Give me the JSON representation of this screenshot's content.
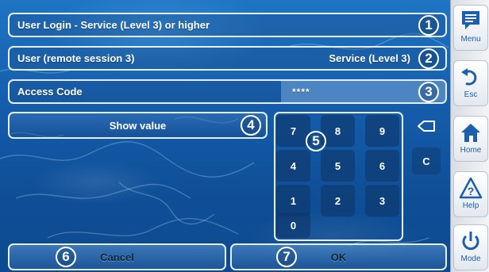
{
  "login_row": {
    "label": "User Login - Service (Level 3) or higher",
    "marker": "1"
  },
  "user_row": {
    "label": "User (remote session 3)",
    "value": "Service (Level 3)",
    "marker": "2"
  },
  "access_row": {
    "label": "Access Code",
    "value": "****",
    "marker": "3"
  },
  "show_value": {
    "label": "Show value",
    "marker": "4"
  },
  "keypad": {
    "marker": "5",
    "keys": [
      "7",
      "8",
      "9",
      "4",
      "5",
      "6",
      "1",
      "2",
      "3",
      "0"
    ],
    "clear_label": "C"
  },
  "cancel": {
    "label": "Cancel",
    "marker": "6"
  },
  "ok": {
    "label": "OK",
    "marker": "7"
  },
  "sidebar": {
    "menu": "Menu",
    "esc": "Esc",
    "home": "Home",
    "help": "Help",
    "mode": "Mode"
  },
  "colors": {
    "accent": "#1c5fae",
    "background": "#155fae",
    "border": "#e7eef7"
  }
}
